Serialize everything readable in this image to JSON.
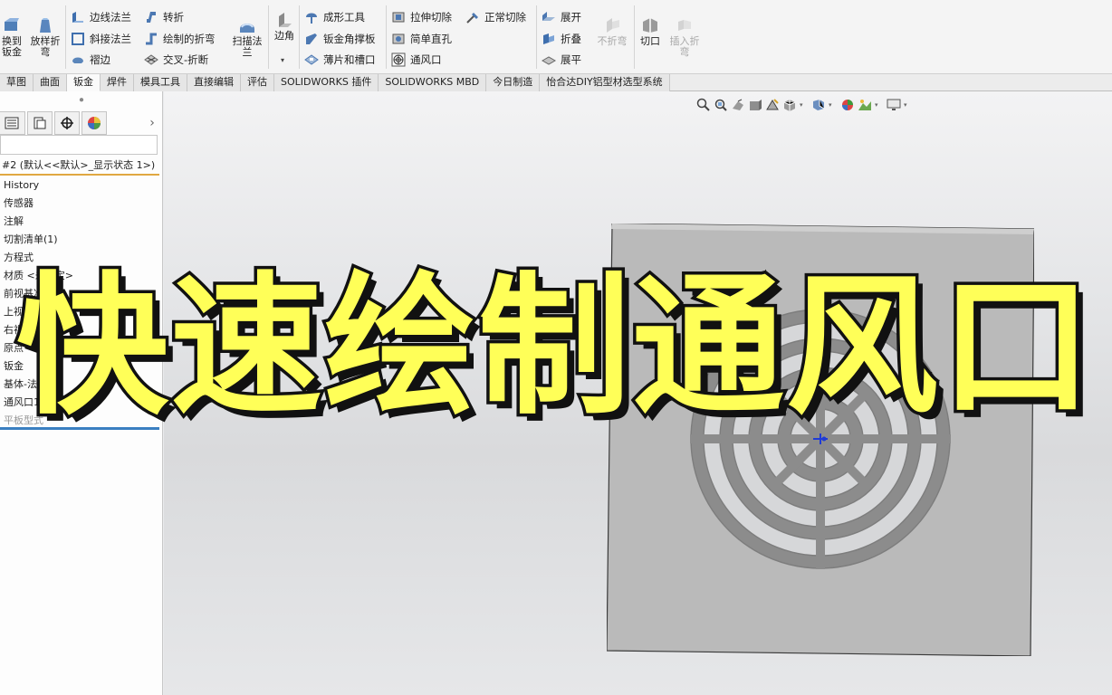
{
  "ribbon": {
    "convert": {
      "label": "换到\n钣金",
      "icon": "convert-to-sheetmetal-icon"
    },
    "lofted": {
      "label": "放样折\n弯",
      "icon": "lofted-bend-icon"
    },
    "col2": [
      {
        "label": "边线法兰",
        "icon": "edge-flange-icon"
      },
      {
        "label": "斜接法兰",
        "icon": "miter-flange-icon"
      },
      {
        "label": "褶边",
        "icon": "hem-icon"
      }
    ],
    "col3": [
      {
        "label": "转折",
        "icon": "jog-icon"
      },
      {
        "label": "绘制的折弯",
        "icon": "sketched-bend-icon"
      },
      {
        "label": "交叉-折断",
        "icon": "cross-break-icon"
      }
    ],
    "swept": {
      "label": "扫描法\n兰",
      "icon": "swept-flange-icon"
    },
    "corner": {
      "label": "边角",
      "icon": "corner-icon"
    },
    "col5": [
      {
        "label": "成形工具",
        "icon": "forming-tool-icon"
      },
      {
        "label": "钣金角撑板",
        "icon": "sheetmetal-gusset-icon"
      },
      {
        "label": "薄片和槽口",
        "icon": "tab-slot-icon"
      }
    ],
    "col6": [
      {
        "label": "拉伸切除",
        "icon": "extruded-cut-icon"
      },
      {
        "label": "简单直孔",
        "icon": "simple-hole-icon"
      },
      {
        "label": "通风口",
        "icon": "vent-icon"
      }
    ],
    "col7": [
      {
        "label": "正常切除",
        "icon": "normal-cut-icon"
      }
    ],
    "col8": [
      {
        "label": "展开",
        "icon": "unfold-icon"
      },
      {
        "label": "折叠",
        "icon": "fold-icon"
      },
      {
        "label": "展平",
        "icon": "flatten-icon"
      }
    ],
    "nobend": {
      "label": "不折弯",
      "icon": "no-bend-icon"
    },
    "rip": {
      "label": "切口",
      "icon": "rip-icon"
    },
    "insertbend": {
      "label": "插入折\n弯",
      "icon": "insert-bends-icon"
    }
  },
  "tabs": [
    {
      "label": "草图",
      "active": false
    },
    {
      "label": "曲面",
      "active": false
    },
    {
      "label": "钣金",
      "active": true
    },
    {
      "label": "焊件",
      "active": false
    },
    {
      "label": "模具工具",
      "active": false
    },
    {
      "label": "直接编辑",
      "active": false
    },
    {
      "label": "评估",
      "active": false
    },
    {
      "label": "SOLIDWORKS 插件",
      "active": false
    },
    {
      "label": "SOLIDWORKS MBD",
      "active": false
    },
    {
      "label": "今日制造",
      "active": false
    },
    {
      "label": "怡合达DIY铝型材选型系统",
      "active": false
    }
  ],
  "panel": {
    "grip": "⦁",
    "root": "#2 (默认<<默认>_显示状态 1>)",
    "items": [
      {
        "label": "History",
        "dim": false
      },
      {
        "label": "传感器",
        "dim": false
      },
      {
        "label": "注解",
        "dim": false
      },
      {
        "label": "切割清单(1)",
        "dim": false
      },
      {
        "label": "方程式",
        "dim": false
      },
      {
        "label": "材质 <未指定>",
        "dim": false
      },
      {
        "label": "前视基准面",
        "dim": false
      },
      {
        "label": "上视基准面",
        "dim": false
      },
      {
        "label": "右视基准面",
        "dim": false
      },
      {
        "label": "原点",
        "dim": false
      },
      {
        "label": "钣金",
        "dim": false
      },
      {
        "label": "基体-法兰1",
        "dim": false
      },
      {
        "label": "通风口1",
        "dim": false
      },
      {
        "label": "平板型式",
        "dim": true
      }
    ],
    "more_glyph": "›"
  },
  "overlay": {
    "title": "快速绘制通风口"
  },
  "colors": {
    "title_fill": "#ffff58",
    "title_stroke": "#111111",
    "sheet": "#b9b9b9",
    "vent_bg": "#d4d5d7",
    "active_tab_line": "#e0a841"
  }
}
